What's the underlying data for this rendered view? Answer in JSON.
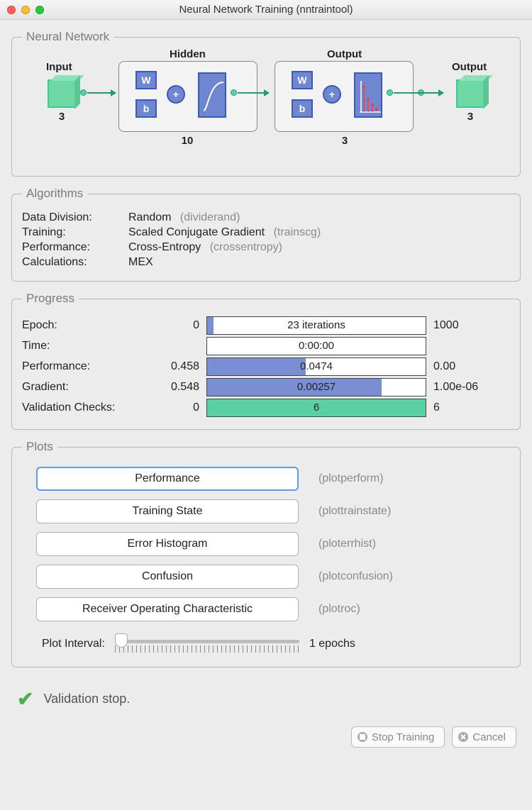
{
  "window": {
    "title": "Neural Network Training (nntraintool)"
  },
  "network": {
    "legend": "Neural Network",
    "input_label": "Input",
    "input_size": "3",
    "hidden_label": "Hidden",
    "hidden_size": "10",
    "output_layer_label": "Output",
    "output_layer_size": "3",
    "output_label": "Output",
    "output_size": "3",
    "w_label": "W",
    "b_label": "b",
    "plus_label": "+"
  },
  "algorithms": {
    "legend": "Algorithms",
    "rows": [
      {
        "label": "Data Division:",
        "value": "Random",
        "hint": "(dividerand)"
      },
      {
        "label": "Training:",
        "value": "Scaled Conjugate Gradient",
        "hint": "(trainscg)"
      },
      {
        "label": "Performance:",
        "value": "Cross-Entropy",
        "hint": "(crossentropy)"
      },
      {
        "label": "Calculations:",
        "value": "MEX",
        "hint": ""
      }
    ]
  },
  "progress": {
    "legend": "Progress",
    "rows": [
      {
        "label": "Epoch:",
        "left": "0",
        "text": "23 iterations",
        "fill_pct": 3,
        "color": "blue",
        "right": "1000"
      },
      {
        "label": "Time:",
        "left": "",
        "text": "0:00:00",
        "fill_pct": 0,
        "color": "blue",
        "right": ""
      },
      {
        "label": "Performance:",
        "left": "0.458",
        "text": "0.0474",
        "fill_pct": 45,
        "color": "blue",
        "right": "0.00"
      },
      {
        "label": "Gradient:",
        "left": "0.548",
        "text": "0.00257",
        "fill_pct": 80,
        "color": "blue",
        "right": "1.00e-06"
      },
      {
        "label": "Validation Checks:",
        "left": "0",
        "text": "6",
        "fill_pct": 100,
        "color": "green",
        "right": "6"
      }
    ]
  },
  "plots": {
    "legend": "Plots",
    "buttons": [
      {
        "label": "Performance",
        "hint": "(plotperform)",
        "focused": true
      },
      {
        "label": "Training State",
        "hint": "(plottrainstate)",
        "focused": false
      },
      {
        "label": "Error Histogram",
        "hint": "(ploterrhist)",
        "focused": false
      },
      {
        "label": "Confusion",
        "hint": "(plotconfusion)",
        "focused": false
      },
      {
        "label": "Receiver Operating Characteristic",
        "hint": "(plotroc)",
        "focused": false
      }
    ],
    "interval_label": "Plot Interval:",
    "interval_value": "1 epochs"
  },
  "status": {
    "message": "Validation stop."
  },
  "footer": {
    "stop_label": "Stop Training",
    "cancel_label": "Cancel"
  }
}
